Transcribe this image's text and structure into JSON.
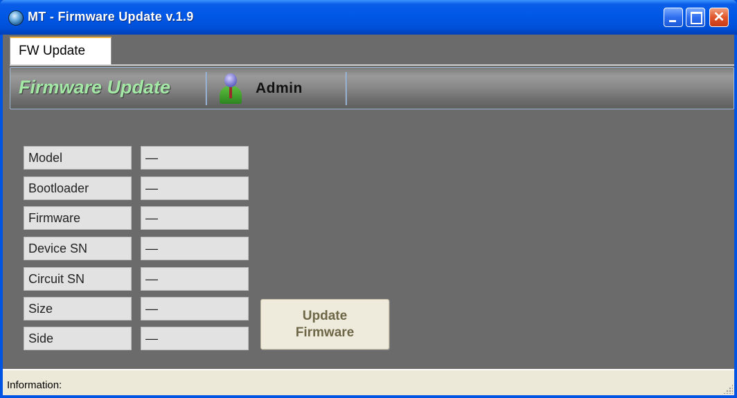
{
  "window": {
    "title": "MT - Firmware Update v.1.9",
    "icon": "globe-icon",
    "controls": [
      "minimize",
      "maximize",
      "close"
    ]
  },
  "tabs": [
    {
      "label": "FW Update",
      "selected": true
    }
  ],
  "header": {
    "title": "Firmware Update",
    "user_icon": "user-icon",
    "user_name": "Admin"
  },
  "fields": [
    {
      "label": "Model",
      "value": "—"
    },
    {
      "label": "Bootloader",
      "value": "—"
    },
    {
      "label": "Firmware",
      "value": "—"
    },
    {
      "label": "Device SN",
      "value": "—"
    },
    {
      "label": "Circuit SN",
      "value": "—"
    },
    {
      "label": "Size",
      "value": "—"
    },
    {
      "label": "Side",
      "value": "—"
    }
  ],
  "update_button": {
    "label_line1": "Update",
    "label_line2": "Firmware"
  },
  "status": {
    "label": "Information:"
  },
  "colors": {
    "title_bar": "#0058e6",
    "background": "#6b6b6b",
    "header_title": "#a4e8a6",
    "field_bg": "#e2e2e2",
    "button_bg": "#eeeadc",
    "status_bg": "#ece9d8"
  }
}
